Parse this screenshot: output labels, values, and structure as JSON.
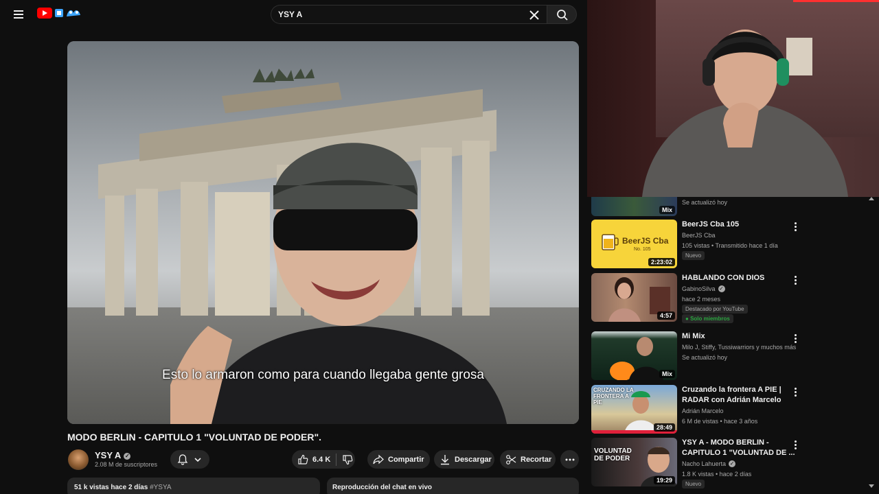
{
  "header": {
    "search_value": "YSY A"
  },
  "player": {
    "subtitle": "Esto lo armaron como para cuando llegaba gente grosa"
  },
  "video": {
    "title": "MODO BERLIN - CAPITULO 1 \"VOLUNTAD DE PODER\".",
    "channel": "YSY A",
    "subscribers": "2.08 M de suscriptores",
    "likes": "6.4 K",
    "share_label": "Compartir",
    "download_label": "Descargar",
    "clip_label": "Recortar",
    "views_date": "51 k vistas  hace 2 días",
    "hashtag": "#YSYA",
    "chat_replay": "Reproducción del chat en vivo"
  },
  "sidebar": {
    "partial_mix": {
      "badge": "Mix",
      "line": "Se actualizó hoy"
    },
    "items": [
      {
        "title": "BeerJS Cba 105",
        "channel": "BeerJS Cba",
        "meta": "105 vistas • Transmitido hace 1 día",
        "badge": "Nuevo",
        "duration": "2:23:02",
        "thumb_text": "BeerJS Cba",
        "thumb_sub": "No. 105"
      },
      {
        "title": "HABLANDO CON DIOS",
        "channel": "GabinoSilva",
        "meta": "hace 2 meses",
        "badge": "Destacado por YouTube",
        "members": "Solo miembros",
        "duration": "4:57"
      },
      {
        "title": "Mi Mix",
        "channel": "Milo J, Stiffy, Tussiwarriors y muchos más",
        "meta": "Se actualizó hoy",
        "mix": "Mix"
      },
      {
        "title": "Cruzando la frontera A PIE | RADAR con Adrián Marcelo",
        "channel": "Adrián Marcelo",
        "meta": "6 M de vistas • hace 3 años",
        "duration": "28:49",
        "thumb_text": "CRUZANDO LA FRONTERA A PIE"
      },
      {
        "title": "YSY A - MODO BERLIN - CAPITULO 1 \"VOLUNTAD DE ...",
        "channel": "Nacho Lahuerta",
        "meta": "1.8 K vistas • hace 2 días",
        "badge": "Nuevo",
        "duration": "19:29",
        "thumb_text": "VOLUNTAD DE PODER"
      }
    ]
  },
  "colors": {
    "background": "#0f0f0f",
    "pill": "#272727",
    "accent_red": "#ff0000",
    "member_green": "#2ba640",
    "beerjs_yellow": "#f7d43a"
  }
}
